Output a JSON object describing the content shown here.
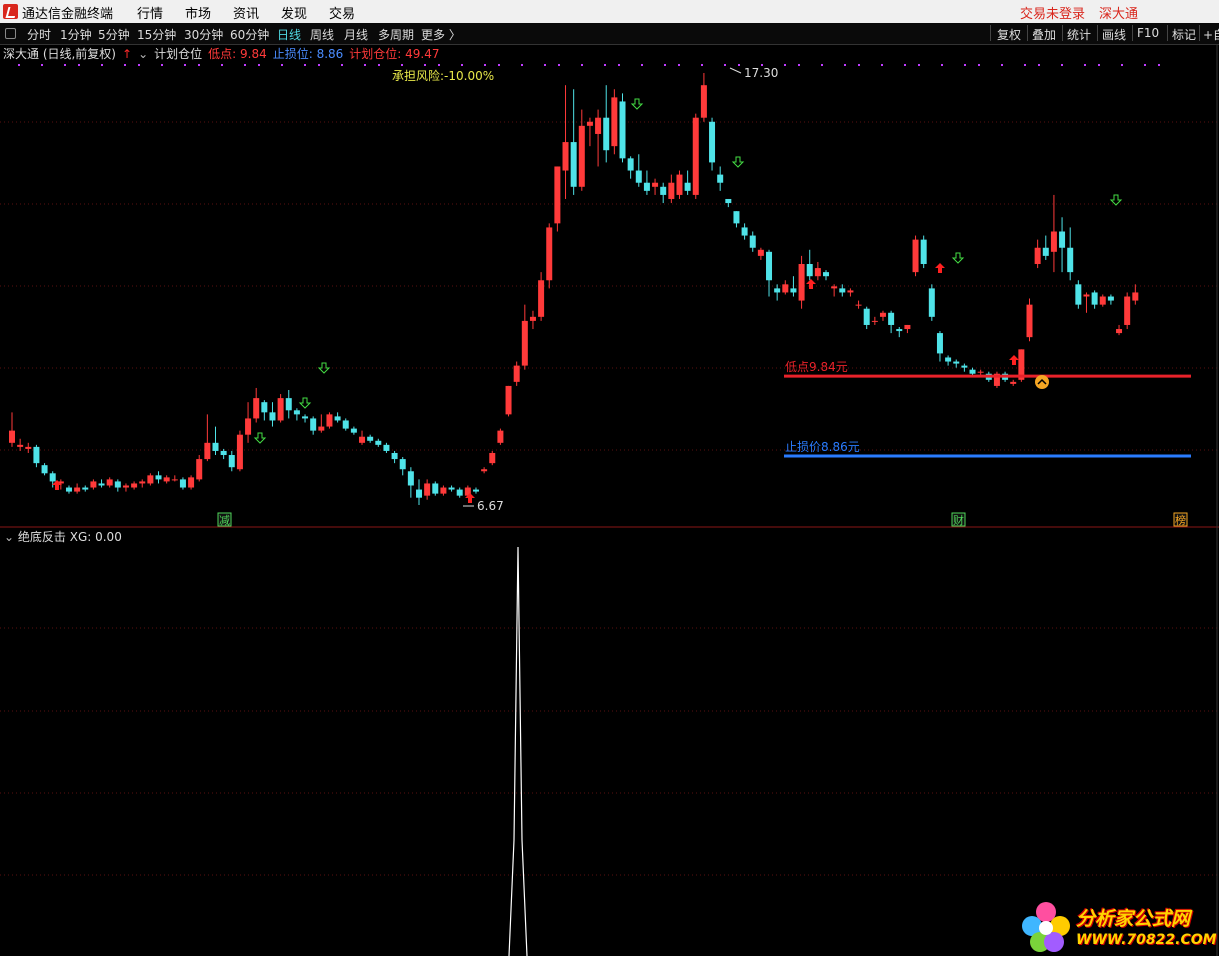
{
  "app": {
    "name": "通达信金融终端",
    "menus": [
      "行情",
      "市场",
      "资讯",
      "发现",
      "交易"
    ],
    "login_status": "交易未登录",
    "exchange": "深大通"
  },
  "toolbar": {
    "periods": [
      "分时",
      "1分钟",
      "5分钟",
      "15分钟",
      "30分钟",
      "60分钟",
      "日线",
      "周线",
      "月线",
      "多周期",
      "更多 〉"
    ],
    "active_period": "日线",
    "right_buttons": [
      "复权",
      "叠加",
      "统计",
      "画线",
      "F10",
      "标记",
      "+自"
    ]
  },
  "main_chart": {
    "title": "深大通 (日线,前复权)",
    "indicator": "计划仓位",
    "low_label": "低点: 9.84",
    "stop_label": "止损位: 8.86",
    "position_label": "计划仓位: 49.47",
    "risk_label": "承担风险:-10.00%",
    "high_marker": "17.30",
    "low_marker": "6.67",
    "low_line_label": "低点9.84元",
    "stop_line_label": "止损价8.86元",
    "event_tags": [
      "减",
      "财",
      "榜"
    ],
    "colors": {
      "up": "#ff3a3a",
      "down": "#4fe3e8",
      "low_line": "#e8222a",
      "stop_line": "#2a7cff"
    }
  },
  "sub_chart": {
    "indicator": "绝底反击",
    "xg_label": "XG: 0.00"
  },
  "watermark": {
    "text": "分析家公式网",
    "url": "WWW.70822.COM"
  },
  "chart_data": {
    "type": "candlestick",
    "title": "深大通 (日线,前复权)",
    "price_high": 17.3,
    "price_low": 6.67,
    "low_point": 9.84,
    "stop_price": 8.86,
    "planned_position": 49.47,
    "risk_pct": -10.0,
    "candles": [
      [
        8.2,
        8.5,
        8.95,
        8.1
      ],
      [
        8.1,
        8.15,
        8.3,
        8.0
      ],
      [
        8.05,
        8.1,
        8.2,
        7.95
      ],
      [
        8.1,
        7.7,
        8.15,
        7.6
      ],
      [
        7.65,
        7.45,
        7.7,
        7.4
      ],
      [
        7.45,
        7.25,
        7.5,
        7.1
      ],
      [
        7.2,
        7.25,
        7.3,
        7.05
      ],
      [
        7.1,
        7.0,
        7.15,
        6.95
      ],
      [
        7.0,
        7.1,
        7.2,
        6.95
      ],
      [
        7.1,
        7.05,
        7.15,
        7.0
      ],
      [
        7.1,
        7.25,
        7.3,
        7.05
      ],
      [
        7.2,
        7.15,
        7.3,
        7.1
      ],
      [
        7.15,
        7.3,
        7.35,
        7.1
      ],
      [
        7.25,
        7.1,
        7.3,
        7.0
      ],
      [
        7.1,
        7.15,
        7.2,
        7.0
      ],
      [
        7.1,
        7.2,
        7.25,
        7.05
      ],
      [
        7.2,
        7.25,
        7.3,
        7.1
      ],
      [
        7.2,
        7.4,
        7.45,
        7.15
      ],
      [
        7.4,
        7.3,
        7.5,
        7.2
      ],
      [
        7.25,
        7.35,
        7.4,
        7.2
      ],
      [
        7.3,
        7.3,
        7.4,
        7.25
      ],
      [
        7.3,
        7.1,
        7.35,
        7.05
      ],
      [
        7.1,
        7.35,
        7.4,
        7.05
      ],
      [
        7.3,
        7.8,
        7.9,
        7.25
      ],
      [
        7.8,
        8.2,
        8.9,
        7.75
      ],
      [
        8.2,
        8.0,
        8.6,
        7.9
      ],
      [
        8.0,
        7.9,
        8.05,
        7.8
      ],
      [
        7.9,
        7.6,
        8.0,
        7.5
      ],
      [
        7.55,
        8.4,
        8.5,
        7.5
      ],
      [
        8.4,
        8.8,
        9.2,
        8.2
      ],
      [
        8.8,
        9.3,
        9.55,
        8.7
      ],
      [
        9.2,
        8.95,
        9.25,
        8.75
      ],
      [
        8.95,
        8.75,
        9.2,
        8.6
      ],
      [
        8.75,
        9.3,
        9.4,
        8.7
      ],
      [
        9.3,
        9.0,
        9.5,
        8.8
      ],
      [
        9.0,
        8.9,
        9.05,
        8.75
      ],
      [
        8.85,
        8.8,
        8.9,
        8.7
      ],
      [
        8.8,
        8.5,
        8.85,
        8.4
      ],
      [
        8.5,
        8.6,
        8.9,
        8.45
      ],
      [
        8.6,
        8.9,
        8.95,
        8.55
      ],
      [
        8.85,
        8.75,
        8.95,
        8.7
      ],
      [
        8.75,
        8.55,
        8.8,
        8.5
      ],
      [
        8.55,
        8.45,
        8.6,
        8.4
      ],
      [
        8.2,
        8.35,
        8.5,
        8.15
      ],
      [
        8.35,
        8.25,
        8.4,
        8.2
      ],
      [
        8.25,
        8.15,
        8.3,
        8.1
      ],
      [
        8.15,
        8.0,
        8.2,
        7.95
      ],
      [
        7.95,
        7.8,
        8.0,
        7.7
      ],
      [
        7.8,
        7.55,
        7.85,
        7.4
      ],
      [
        7.5,
        7.15,
        7.6,
        6.85
      ],
      [
        7.05,
        6.85,
        7.3,
        6.67
      ],
      [
        6.9,
        7.2,
        7.3,
        6.8
      ],
      [
        7.2,
        6.95,
        7.25,
        6.9
      ],
      [
        6.95,
        7.1,
        7.15,
        6.9
      ],
      [
        7.1,
        7.05,
        7.15,
        7.0
      ],
      [
        7.05,
        6.9,
        7.1,
        6.85
      ],
      [
        6.9,
        7.1,
        7.15,
        6.85
      ],
      [
        7.05,
        7.0,
        7.1,
        6.95
      ],
      [
        7.5,
        7.55,
        7.6,
        7.45
      ],
      [
        7.7,
        7.95,
        8.0,
        7.65
      ],
      [
        8.2,
        8.5,
        8.55,
        8.15
      ],
      [
        8.9,
        9.6,
        9.6,
        8.85
      ],
      [
        9.7,
        10.1,
        10.2,
        9.6
      ],
      [
        10.1,
        11.2,
        11.6,
        10.0
      ],
      [
        11.2,
        11.3,
        11.45,
        11.0
      ],
      [
        11.3,
        12.2,
        12.4,
        11.2
      ],
      [
        12.2,
        13.5,
        13.6,
        12.0
      ],
      [
        13.6,
        15.0,
        15.0,
        13.4
      ],
      [
        14.9,
        15.6,
        17.0,
        14.2
      ],
      [
        15.6,
        14.5,
        16.9,
        14.3
      ],
      [
        14.5,
        16.0,
        16.4,
        14.4
      ],
      [
        16.0,
        16.1,
        16.2,
        15.5
      ],
      [
        15.8,
        16.2,
        16.4,
        15.0
      ],
      [
        16.2,
        15.4,
        17.0,
        15.1
      ],
      [
        15.5,
        16.7,
        16.9,
        15.3
      ],
      [
        16.6,
        15.2,
        16.8,
        15.1
      ],
      [
        15.2,
        14.9,
        15.25,
        14.7
      ],
      [
        14.9,
        14.6,
        15.3,
        14.5
      ],
      [
        14.6,
        14.4,
        14.9,
        14.3
      ],
      [
        14.5,
        14.6,
        14.7,
        14.3
      ],
      [
        14.5,
        14.3,
        14.6,
        14.1
      ],
      [
        14.2,
        14.6,
        14.8,
        14.1
      ],
      [
        14.3,
        14.8,
        14.9,
        14.2
      ],
      [
        14.6,
        14.4,
        14.9,
        14.3
      ],
      [
        14.3,
        16.2,
        16.3,
        14.2
      ],
      [
        16.2,
        17.0,
        17.3,
        16.1
      ],
      [
        16.1,
        15.1,
        16.2,
        14.9
      ],
      [
        14.8,
        14.6,
        15.0,
        14.4
      ],
      [
        14.2,
        14.1,
        14.2,
        14.0
      ],
      [
        13.9,
        13.6,
        13.9,
        13.5
      ],
      [
        13.5,
        13.3,
        13.6,
        13.2
      ],
      [
        13.3,
        13.0,
        13.4,
        12.9
      ],
      [
        12.8,
        12.95,
        13.0,
        12.7
      ],
      [
        12.9,
        12.2,
        12.95,
        11.8
      ],
      [
        12.0,
        11.9,
        12.1,
        11.7
      ],
      [
        11.9,
        12.1,
        12.2,
        11.85
      ],
      [
        12.0,
        11.9,
        12.3,
        11.8
      ],
      [
        11.7,
        12.6,
        12.8,
        11.5
      ],
      [
        12.6,
        12.3,
        12.95,
        12.2
      ],
      [
        12.3,
        12.5,
        12.65,
        12.2
      ],
      [
        12.4,
        12.3,
        12.45,
        12.2
      ],
      [
        12.0,
        12.05,
        12.1,
        11.8
      ],
      [
        12.0,
        11.9,
        12.1,
        11.8
      ],
      [
        11.9,
        11.95,
        12.0,
        11.8
      ],
      [
        11.6,
        11.6,
        11.7,
        11.5
      ],
      [
        11.5,
        11.1,
        11.55,
        11.0
      ],
      [
        11.2,
        11.2,
        11.3,
        11.1
      ],
      [
        11.3,
        11.4,
        11.45,
        11.2
      ],
      [
        11.4,
        11.1,
        11.45,
        10.9
      ],
      [
        11.0,
        10.95,
        11.05,
        10.8
      ],
      [
        11.0,
        11.1,
        11.1,
        10.9
      ],
      [
        12.4,
        13.2,
        13.3,
        12.3
      ],
      [
        13.2,
        12.6,
        13.3,
        12.5
      ],
      [
        12.0,
        11.3,
        12.1,
        11.2
      ],
      [
        10.9,
        10.4,
        10.95,
        10.2
      ],
      [
        10.3,
        10.2,
        10.35,
        10.1
      ],
      [
        10.2,
        10.15,
        10.25,
        10.05
      ],
      [
        10.1,
        10.05,
        10.15,
        9.95
      ],
      [
        10.0,
        9.9,
        10.05,
        9.85
      ],
      [
        9.95,
        9.95,
        10.0,
        9.85
      ],
      [
        9.9,
        9.75,
        9.95,
        9.7
      ],
      [
        9.6,
        9.9,
        9.95,
        9.55
      ],
      [
        9.9,
        9.75,
        9.95,
        9.7
      ],
      [
        9.65,
        9.7,
        9.75,
        9.6
      ],
      [
        9.75,
        10.5,
        10.5,
        9.7
      ],
      [
        10.8,
        11.6,
        11.75,
        10.7
      ],
      [
        12.6,
        13.0,
        13.2,
        12.5
      ],
      [
        13.0,
        12.8,
        13.3,
        12.7
      ],
      [
        12.9,
        13.4,
        14.3,
        12.4
      ],
      [
        13.4,
        13.0,
        13.75,
        12.4
      ],
      [
        13.0,
        12.4,
        13.5,
        12.2
      ],
      [
        12.1,
        11.6,
        12.2,
        11.5
      ],
      [
        11.8,
        11.85,
        11.9,
        11.4
      ],
      [
        11.9,
        11.6,
        11.95,
        11.5
      ],
      [
        11.6,
        11.8,
        11.85,
        11.55
      ],
      [
        11.8,
        11.7,
        11.85,
        11.6
      ],
      [
        10.9,
        11.0,
        11.1,
        10.85
      ],
      [
        11.1,
        11.8,
        11.9,
        11.0
      ],
      [
        11.7,
        11.9,
        12.1,
        11.6
      ]
    ]
  }
}
